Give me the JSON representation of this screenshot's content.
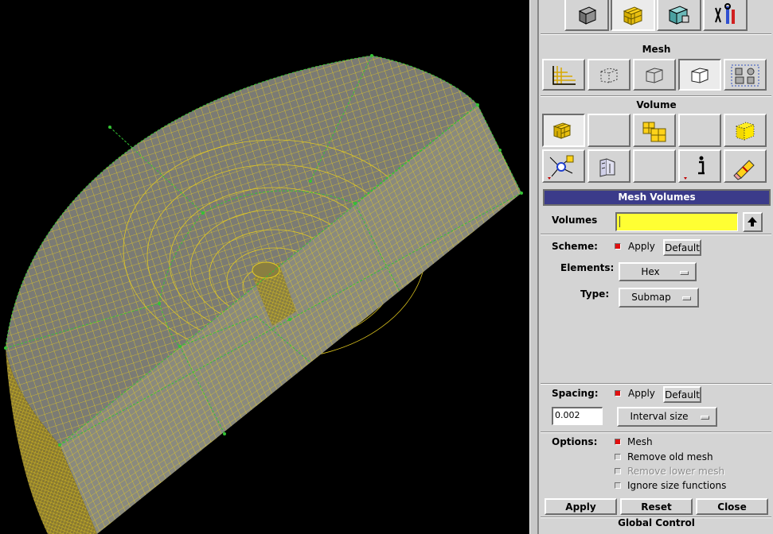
{
  "viewport": {
    "colors": {
      "background": "#000000",
      "mesh_fill": "#7b7b74",
      "mesh_lines": "#e6cc1f",
      "curves": "#34c234"
    }
  },
  "toolbar": {
    "mode_icons": [
      "geometry-cube-icon",
      "mesh-cube-icon",
      "boundary-conditions-icon",
      "tools-icon"
    ]
  },
  "mesh_section": {
    "title": "Mesh",
    "icons": [
      "mesh-grid-icon",
      "mesh-curve-icon",
      "mesh-surface-icon",
      "mesh-volume-icon",
      "mesh-group-icon"
    ]
  },
  "volume_section": {
    "title": "Volume",
    "icons_row1": [
      "mesh-volume-yellow-icon",
      "blank-button",
      "submap-icon",
      "blank-button",
      "dotted-cube-icon"
    ],
    "icons_row2": [
      "smooth-icon",
      "sweep-icon",
      "blank-button",
      "info-icon",
      "erase-icon"
    ]
  },
  "form": {
    "title": "Mesh Volumes",
    "volumes_label": "Volumes",
    "volumes_value": "",
    "scheme_label": "Scheme:",
    "scheme_apply": "Apply",
    "scheme_default": "Default",
    "elements_label": "Elements:",
    "elements_value": "Hex",
    "type_label": "Type:",
    "type_value": "Submap",
    "spacing_label": "Spacing:",
    "spacing_apply": "Apply",
    "spacing_default": "Default",
    "spacing_value": "0.002",
    "spacing_mode": "Interval size",
    "options_label": "Options:",
    "options": [
      {
        "label": "Mesh",
        "checked": true,
        "disabled": false
      },
      {
        "label": "Remove old mesh",
        "checked": false,
        "disabled": false
      },
      {
        "label": "Remove lower mesh",
        "checked": false,
        "disabled": true
      },
      {
        "label": "Ignore size functions",
        "checked": false,
        "disabled": false
      }
    ],
    "apply_button": "Apply",
    "reset_button": "Reset",
    "close_button": "Close"
  },
  "footer": {
    "next_section": "Global Control"
  },
  "colors": {
    "title_bar": "#3b3b8a",
    "volumes_field": "#ffff33",
    "check_on": "#e01010",
    "panel_bg": "#d4d4d4"
  }
}
